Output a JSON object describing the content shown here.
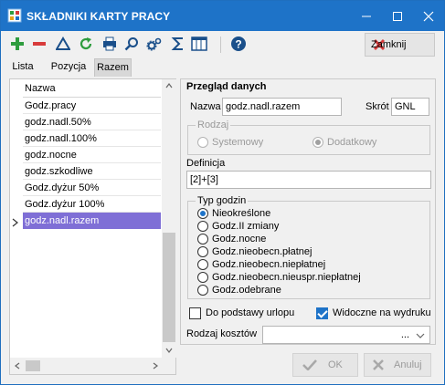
{
  "window": {
    "title": "SKŁADNIKI KARTY PRACY",
    "controls": [
      "minimize-icon",
      "maximize-icon",
      "close-icon"
    ]
  },
  "toolbar": {
    "icons": [
      "add-icon",
      "delete-icon",
      "filter-icon",
      "refresh-icon",
      "print-icon",
      "search-icon",
      "settings-icon",
      "sum-icon",
      "columns-icon",
      "help-icon"
    ],
    "close_label": "Zamknij"
  },
  "tabs": [
    {
      "label": "Lista",
      "active": false
    },
    {
      "label": "Pozycja",
      "active": false
    },
    {
      "label": "Razem",
      "active": true
    }
  ],
  "list": {
    "header": "Nazwa",
    "rows": [
      "Godz.pracy",
      "godz.nadl.50%",
      "godz.nadl.100%",
      "godz.nocne",
      "godz.szkodliwe",
      "Godz.dyżur 50%",
      "Godz.dyżur 100%",
      "godz.nadl.razem"
    ],
    "selected_index": 7
  },
  "details": {
    "section_title": "Przegląd danych",
    "name_label": "Nazwa",
    "name_value": "godz.nadl.razem",
    "short_label": "Skrót",
    "short_value": "GNL",
    "kind_legend": "Rodzaj",
    "kind_options": [
      {
        "label": "Systemowy",
        "selected": false
      },
      {
        "label": "Dodatkowy",
        "selected": true
      }
    ],
    "definition_label": "Definicja",
    "definition_value": "[2]+[3]",
    "hours_legend": "Typ godzin",
    "hours_options": [
      {
        "label": "Nieokreślone",
        "selected": true
      },
      {
        "label": "Godz.II zmiany",
        "selected": false
      },
      {
        "label": "Godz.nocne",
        "selected": false
      },
      {
        "label": "Godz.nieobecn.płatnej",
        "selected": false
      },
      {
        "label": "Godz.nieobecn.niepłatnej",
        "selected": false
      },
      {
        "label": "Godz.nieobecn.nieuspr.niepłatnej",
        "selected": false
      },
      {
        "label": "Godz.odebrane",
        "selected": false
      }
    ],
    "vacation_label": "Do podstawy urlopu",
    "vacation_checked": false,
    "printout_label": "Widoczne na wydruku",
    "printout_checked": true,
    "cost_type_label": "Rodzaj kosztów",
    "cost_type_value": "..."
  },
  "buttons": {
    "ok_label": "OK",
    "cancel_label": "Anuluj"
  },
  "colors": {
    "titlebar": "#1e73c8",
    "selection": "#7f6fd6",
    "accent_blue": "#1e73c8"
  }
}
